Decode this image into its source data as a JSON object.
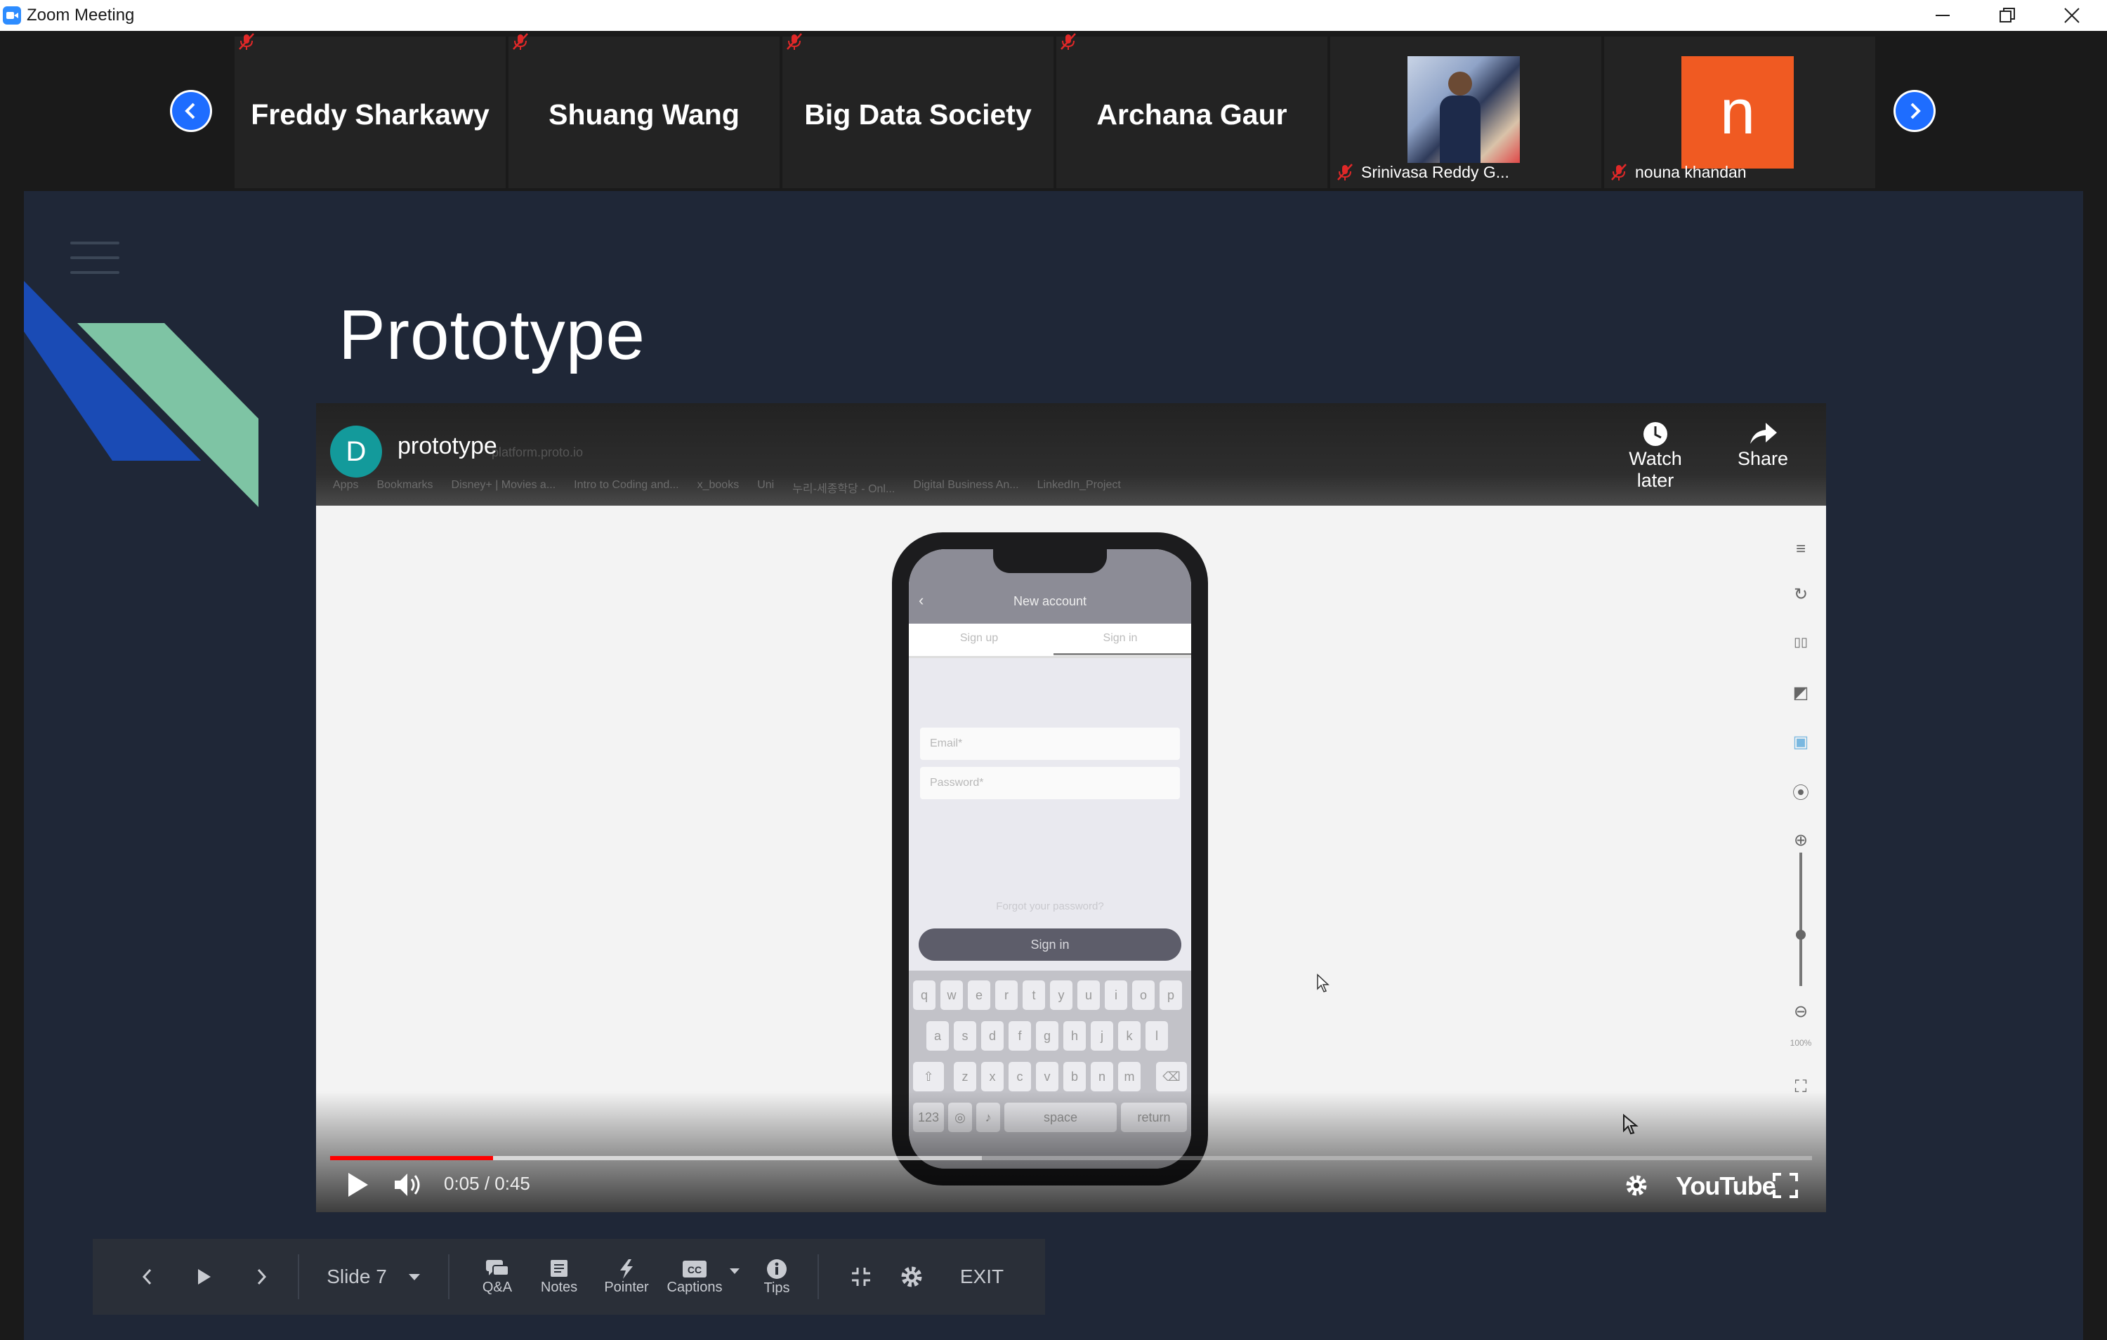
{
  "window": {
    "title": "Zoom Meeting",
    "controls": [
      "minimize",
      "restore",
      "close"
    ]
  },
  "gallery": {
    "participants": [
      {
        "name": "Freddy Sharkawy",
        "muted": true
      },
      {
        "name": "Shuang Wang",
        "muted": true
      },
      {
        "name": "Big Data Society",
        "muted": true
      },
      {
        "name": "Archana Gaur",
        "muted": true
      },
      {
        "name": "Srinivasa Reddy G...",
        "muted": true,
        "video": "photo"
      },
      {
        "name": "nouna khandan",
        "muted": true,
        "avatar_letter": "n",
        "avatar_color": "#f05a22"
      }
    ]
  },
  "slide": {
    "title": "Prototype",
    "accent_colors": [
      "#1a4bb5",
      "#7ec4a4"
    ]
  },
  "video": {
    "channel_initial": "D",
    "title": "prototype",
    "url_text": "platform.proto.io",
    "bookmarks": [
      "Apps",
      "Bookmarks",
      "Disney+ | Movies a...",
      "Intro to Coding and...",
      "x_books",
      "Uni",
      "누리-세종학당 - Onl...",
      "Digital Business An...",
      "LinkedIn_Project"
    ],
    "watch_later": "Watch later",
    "share": "Share",
    "time": "0:05 / 0:45",
    "progress": 0.11,
    "buffered": 0.44,
    "brand": "YouTube",
    "phone": {
      "header": "New account",
      "tab_left": "Sign up",
      "tab_right": "Sign in",
      "email_placeholder": "Email*",
      "password_placeholder": "Password*",
      "forgot": "Forgot your password?",
      "signin": "Sign in",
      "keys_row1": [
        "q",
        "w",
        "e",
        "r",
        "t",
        "y",
        "u",
        "i",
        "o",
        "p"
      ],
      "keys_row2": [
        "a",
        "s",
        "d",
        "f",
        "g",
        "h",
        "j",
        "k",
        "l"
      ],
      "keys_row3": [
        "z",
        "x",
        "c",
        "v",
        "b",
        "n",
        "m"
      ],
      "space": "space",
      "return": "return"
    },
    "zoom_readout": "100%"
  },
  "toolbar": {
    "slide_label": "Slide 7",
    "qa": "Q&A",
    "notes": "Notes",
    "pointer": "Pointer",
    "captions": "Captions",
    "tips": "Tips",
    "exit": "EXIT"
  }
}
